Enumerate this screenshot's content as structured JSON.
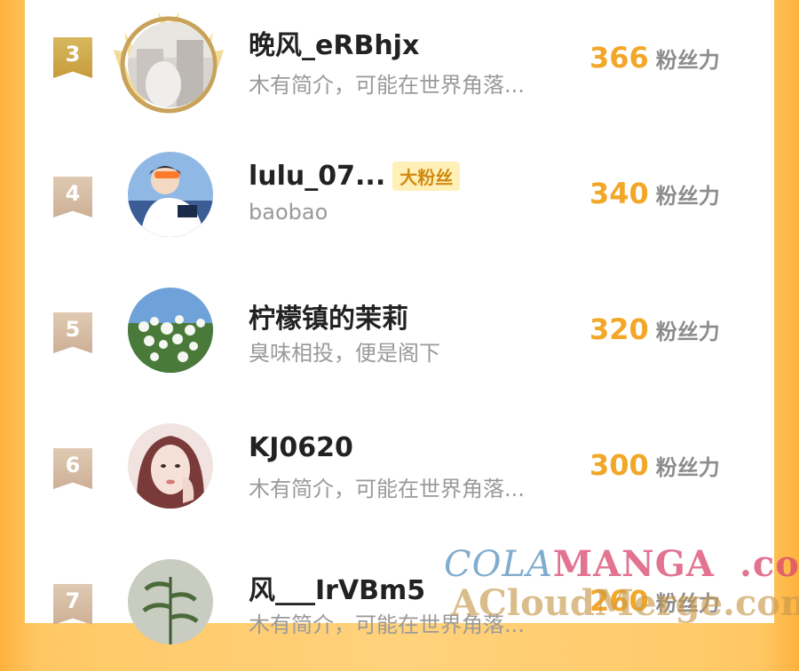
{
  "ranking": {
    "unit_label": "粉丝力",
    "entries": [
      {
        "rank": "3",
        "name": "晚风_eRBhjx",
        "bio": "木有简介，可能在世界角落...",
        "score": "366",
        "badge": ""
      },
      {
        "rank": "4",
        "name": "lulu_07...",
        "bio": "baobao",
        "score": "340",
        "badge": "大粉丝"
      },
      {
        "rank": "5",
        "name": "柠檬镇的茉莉",
        "bio": "臭味相投，便是阁下",
        "score": "320",
        "badge": ""
      },
      {
        "rank": "6",
        "name": "KJ0620",
        "bio": "木有简介，可能在世界角落...",
        "score": "300",
        "badge": ""
      },
      {
        "rank": "7",
        "name": "风___IrVBm5",
        "bio": "木有简介，可能在世界角落...",
        "score": "260",
        "badge": ""
      }
    ]
  },
  "watermark": {
    "cola": "COLA",
    "manga": "MANGA",
    "com": ".com",
    "line2": "ACloudMerge.com"
  },
  "colors": {
    "accent_orange": "#f2a728",
    "frame_orange": "#ffc865",
    "rank_gold": "#c79b3c",
    "rank_plain": "#cdb096"
  }
}
